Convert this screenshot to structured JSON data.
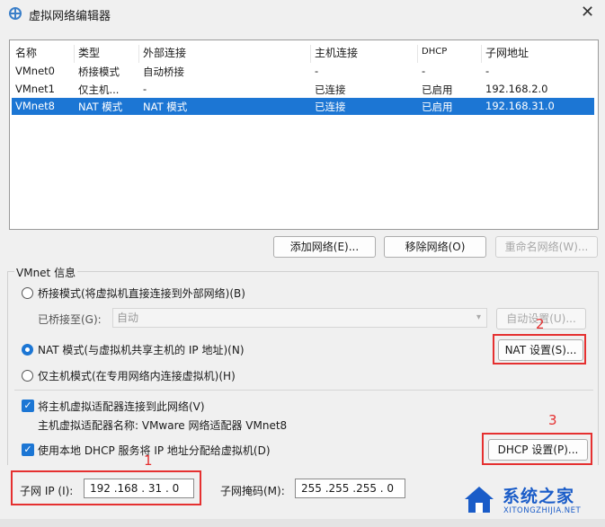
{
  "window": {
    "title": "虚拟网络编辑器",
    "close_icon": "close-icon"
  },
  "table": {
    "headers": [
      "名称",
      "类型",
      "外部连接",
      "主机连接",
      "DHCP",
      "子网地址"
    ],
    "rows": [
      [
        "VMnet0",
        "桥接模式",
        "自动桥接",
        "-",
        "-",
        "-"
      ],
      [
        "VMnet1",
        "仅主机...",
        "-",
        "已连接",
        "已启用",
        "192.168.2.0"
      ],
      [
        "VMnet8",
        "NAT 模式",
        "NAT 模式",
        "已连接",
        "已启用",
        "192.168.31.0"
      ]
    ],
    "selected_index": 2
  },
  "table_buttons": {
    "add": "添加网络(E)...",
    "remove": "移除网络(O)",
    "rename": "重命名网络(W)..."
  },
  "vmnet_info": {
    "group_label": "VMnet 信息",
    "bridge_mode": "桥接模式(将虚拟机直接连接到外部网络)(B)",
    "bridged_to_label": "已桥接至(G):",
    "bridged_to_value": "自动",
    "auto_settings": "自动设置(U)...",
    "nat_mode": "NAT 模式(与虚拟机共享主机的 IP 地址)(N)",
    "nat_settings": "NAT 设置(S)...",
    "host_only": "仅主机模式(在专用网络内连接虚拟机)(H)",
    "connect_adapter": "将主机虚拟适配器连接到此网络(V)",
    "adapter_name": "主机虚拟适配器名称: VMware 网络适配器 VMnet8",
    "use_dhcp": "使用本地 DHCP 服务将 IP 地址分配给虚拟机(D)",
    "dhcp_settings": "DHCP 设置(P)...",
    "subnet_ip_label": "子网 IP (I):",
    "subnet_ip_value": "192 .168 . 31 . 0",
    "subnet_mask_label": "子网掩码(M):",
    "subnet_mask_value": "255 .255 .255 . 0"
  },
  "annotations": [
    "1",
    "2",
    "3"
  ],
  "annotation_color": "#e53030",
  "accent_color": "#1c76d4",
  "watermark": {
    "text": "系统之家",
    "sub": "XITONGZHIJIA.NET"
  }
}
